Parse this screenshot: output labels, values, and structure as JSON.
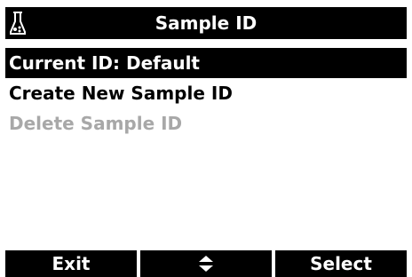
{
  "header": {
    "icon": "flask-icon",
    "title": "Sample ID"
  },
  "menu": {
    "items": [
      {
        "label": "Current ID: Default",
        "state": "selected"
      },
      {
        "label": "Create New Sample ID",
        "state": "enabled"
      },
      {
        "label": "Delete Sample ID",
        "state": "disabled"
      }
    ]
  },
  "softkeys": {
    "left_label": "Exit",
    "center_icon": "up-down-arrows-icon",
    "right_label": "Select"
  },
  "colors": {
    "bar": "#000000",
    "text_on_bar": "#ffffff",
    "disabled_text": "#a8a8a8"
  }
}
